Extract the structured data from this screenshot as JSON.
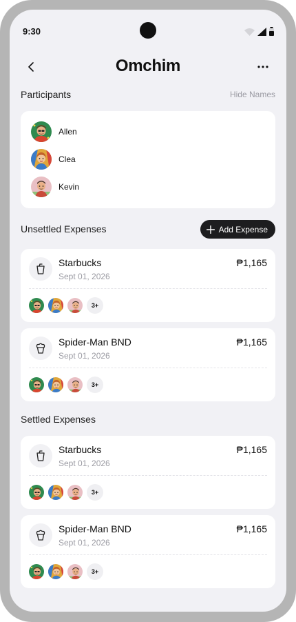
{
  "status_bar": {
    "time": "9:30"
  },
  "header": {
    "title": "Omchim"
  },
  "participants": {
    "title": "Participants",
    "hide_link": "Hide Names",
    "items": [
      {
        "name": "Allen",
        "avatar_bg": "#2f8a4f"
      },
      {
        "name": "Clea",
        "avatar_bg": "#e0a63a"
      },
      {
        "name": "Kevin",
        "avatar_bg": "#e9bfc4"
      }
    ]
  },
  "unsettled": {
    "title": "Unsettled Expenses",
    "add_button": "Add Expense",
    "expenses": [
      {
        "name": "Starbucks",
        "date": "Sept 01, 2026",
        "amount": "₱1,165",
        "icon": "cup-icon",
        "more": "3+"
      },
      {
        "name": "Spider-Man BND",
        "date": "Sept 01, 2026",
        "amount": "₱1,165",
        "icon": "cupcake-icon",
        "more": "3+"
      }
    ]
  },
  "settled": {
    "title": "Settled Expenses",
    "expenses": [
      {
        "name": "Starbucks",
        "date": "Sept 01, 2026",
        "amount": "₱1,165",
        "icon": "cup-icon",
        "more": "3+"
      },
      {
        "name": "Spider-Man BND",
        "date": "Sept 01, 2026",
        "amount": "₱1,165",
        "icon": "cupcake-icon",
        "more": "3+"
      }
    ]
  },
  "colors": {
    "accent": "#1d1d1f",
    "background": "#f1f1f5",
    "muted": "#9a9aa2"
  }
}
